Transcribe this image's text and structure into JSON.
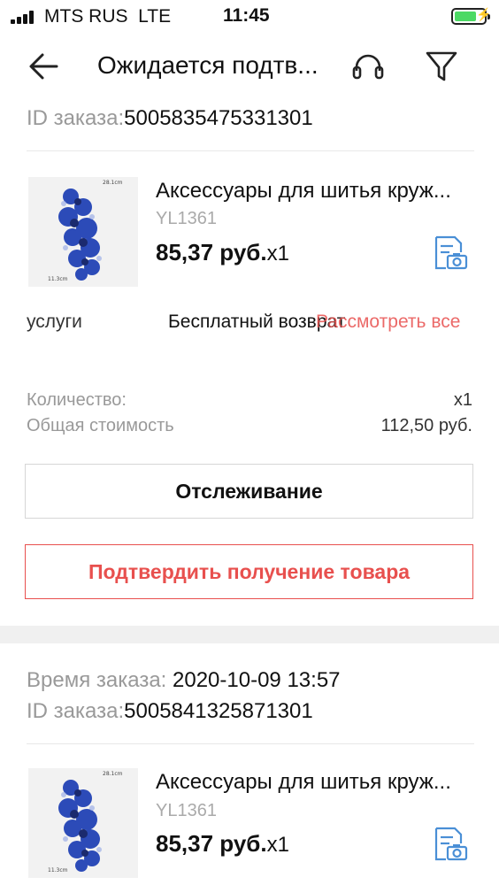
{
  "status_bar": {
    "carrier": "MTS RUS",
    "network": "LTE",
    "time": "11:45"
  },
  "header": {
    "title": "Ожидается подтв..."
  },
  "order1": {
    "order_id_label": "ID заказа:",
    "order_id": "5005835475331301",
    "product": {
      "title": "Аксессуары для шитья круж...",
      "sku": "YL1361",
      "price": "85,37 руб.",
      "qty": "x1",
      "image_label_top": "28.1cm",
      "image_label_bottom": "11.3cm"
    },
    "services_label": "услуги",
    "services_value": "Бесплатный возврат",
    "services_link": "Рассмотреть все",
    "quantity_label": "Количество:",
    "quantity_value": "x1",
    "total_label": "Общая стоимость",
    "total_value": "112,50 руб.",
    "track_button": "Отслеживание",
    "confirm_button": "Подтвердить получение товара"
  },
  "order2": {
    "order_time_label": "Время заказа: ",
    "order_time": "2020-10-09 13:57",
    "order_id_label": "ID заказа:",
    "order_id": "5005841325871301",
    "product": {
      "title": "Аксессуары для шитья круж...",
      "sku": "YL1361",
      "price": "85,37 руб.",
      "qty": "x1",
      "image_label_top": "28.1cm",
      "image_label_bottom": "11.3cm"
    }
  },
  "colors": {
    "accent_red": "#e8504e",
    "link_blue": "#4a8fd6",
    "battery_green": "#4cd964"
  },
  "icons": {
    "back": "arrow-left-icon",
    "support": "headset-icon",
    "filter": "funnel-icon",
    "snapshot": "document-camera-icon"
  }
}
